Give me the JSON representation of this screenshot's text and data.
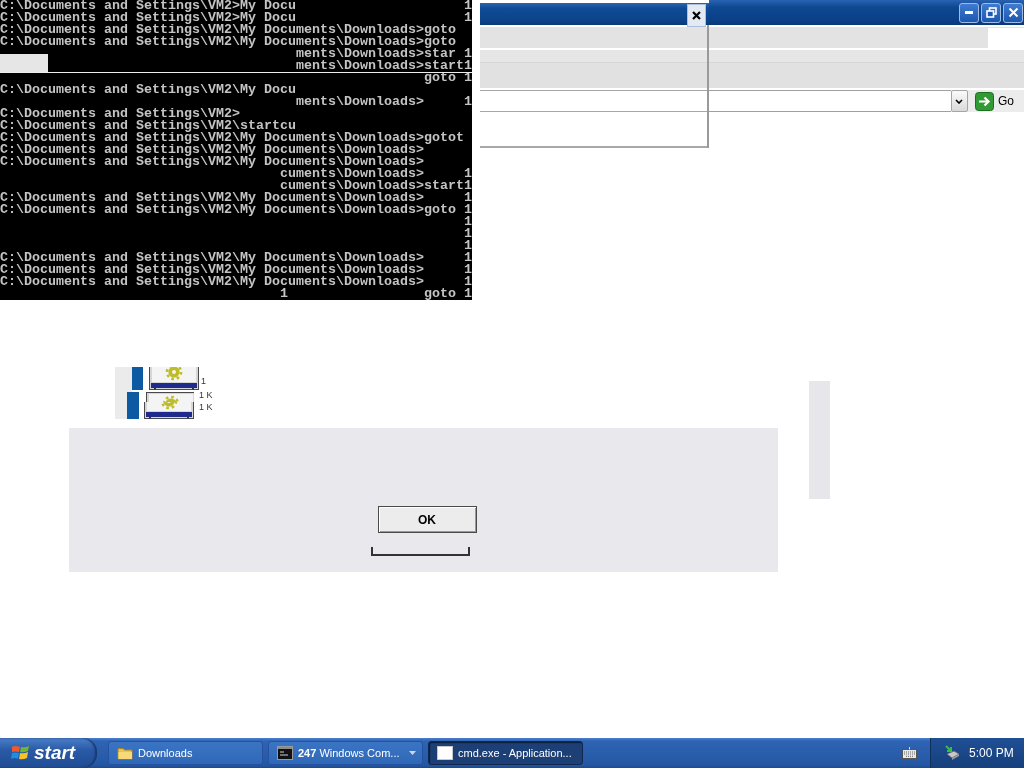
{
  "console": {
    "lines": [
      "C:\\Documents and Settings\\VM2>My Docu                     1",
      "C:\\Documents and Settings\\VM2>My Docu                     1",
      "C:\\Documents and Settings\\VM2\\My Documents\\Downloads>goto",
      "C:\\Documents and Settings\\VM2\\My Documents\\Downloads>goto",
      "                                     ments\\Downloads>star 1",
      "                                     ments\\Downloads>start1",
      "                                                     goto 1",
      "C:\\Documents and Settings\\VM2\\My Docu",
      "                                     ments\\Downloads>     1",
      "C:\\Documents and Settings\\VM2>",
      "C:\\Documents and Settings\\VM2\\startcu",
      "C:\\Documents and Settings\\VM2\\My Documents\\Downloads>gotot",
      "C:\\Documents and Settings\\VM2\\My Documents\\Downloads>",
      "C:\\Documents and Settings\\VM2\\My Documents\\Downloads>",
      "                                   cuments\\Downloads>     1",
      "                                   cuments\\Downloads>start1",
      "C:\\Documents and Settings\\VM2\\My Documents\\Downloads>     1",
      "C:\\Documents and Settings\\VM2\\My Documents\\Downloads>goto 1",
      "                                                          1",
      "                                                          1",
      "                                                          1",
      "C:\\Documents and Settings\\VM2\\My Documents\\Downloads>     1",
      "C:\\Documents and Settings\\VM2\\My Documents\\Downloads>     1",
      "C:\\Documents and Settings\\VM2\\My Documents\\Downloads>     1",
      "                                   1                 goto 1"
    ]
  },
  "browser": {
    "go_label": "Go"
  },
  "file_list_fragment": {
    "items": [
      {
        "size": "1"
      },
      {
        "size": "1 K"
      },
      {
        "size": "1 K"
      }
    ]
  },
  "dialog": {
    "buttons": [
      "OK"
    ]
  },
  "taskbar": {
    "start_label": "start",
    "tasks": [
      {
        "label": "Downloads",
        "kind": "folder",
        "grouped": false,
        "selected": false
      },
      {
        "label": "**247** Windows Com...",
        "kind": "console",
        "grouped": true,
        "selected": false
      },
      {
        "label": "cmd.exe - Application...",
        "kind": "window",
        "grouped": false,
        "selected": true
      }
    ],
    "clock": "5:00 PM"
  }
}
